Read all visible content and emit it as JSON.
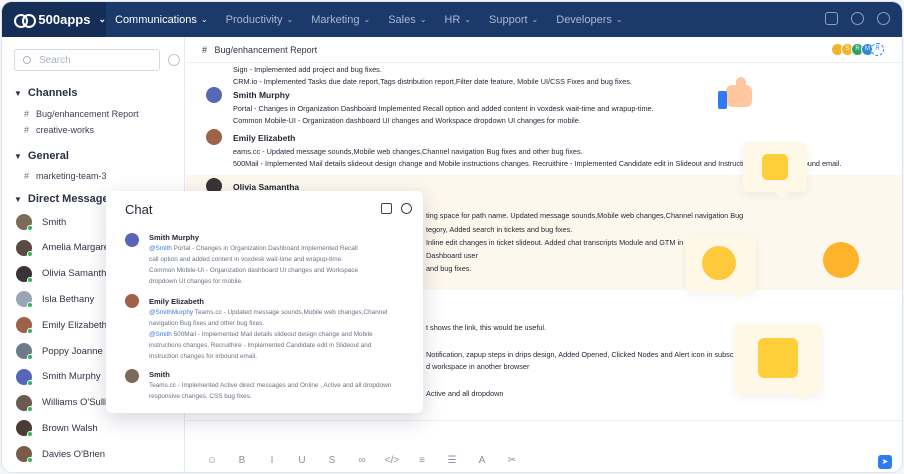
{
  "app": {
    "name": "500apps"
  },
  "nav": {
    "items": [
      {
        "label": "Communications",
        "active": true
      },
      {
        "label": "Productivity"
      },
      {
        "label": "Marketing"
      },
      {
        "label": "Sales"
      },
      {
        "label": "HR"
      },
      {
        "label": "Support"
      },
      {
        "label": "Developers"
      }
    ],
    "icons": [
      "apps-grid-icon",
      "help-icon",
      "settings-icon"
    ]
  },
  "sidebar": {
    "search_placeholder": "Search",
    "channels_title": "Channels",
    "channels": [
      "Bug/enhancement Report",
      "creative-works"
    ],
    "general_title": "General",
    "general": [
      "marketing-team-3"
    ],
    "dm_title": "Direct Messages",
    "direct_messages": [
      {
        "name": "Smith",
        "color": "#7c6a5a"
      },
      {
        "name": "Amelia Margaret",
        "color": "#5a4a42"
      },
      {
        "name": "Olivia Samantha",
        "color": "#3a3438"
      },
      {
        "name": "Isla Bethany",
        "color": "#9aa6b8"
      },
      {
        "name": "Emily Elizabeth",
        "color": "#a0614a"
      },
      {
        "name": "Poppy Joanne",
        "color": "#6e7c8a"
      },
      {
        "name": "Smith Murphy",
        "color": "#5866b8"
      },
      {
        "name": "Williams O'Sullivan",
        "color": "#6a5a50"
      },
      {
        "name": "Brown Walsh",
        "color": "#4a3c36"
      },
      {
        "name": "Davies O'Brien",
        "color": "#7a5c48"
      }
    ]
  },
  "main": {
    "hash": "#",
    "channel_title": "Bug/enhancement Report",
    "members": [
      "",
      "S",
      "R",
      "M",
      "R"
    ],
    "messages": [
      {
        "author": "",
        "lines": [
          "Sign - Implemented add project and bug fixes.",
          "CRM.io - Implemented Tasks due date report,Tags distribution report,Filter date feature, Mobile UI/CSS Fixes and bug fixes."
        ]
      },
      {
        "author": "Smith Murphy",
        "lines": [
          "Portal - Changes in Organization Dashboard Implemented Recall option and added content in voxdesk wait-time and wrapup-time.",
          "Common Mobile-UI - Organization dashboard UI changes and Workspace dropdown UI changes for mobile."
        ]
      },
      {
        "author": "Emily Elizabeth",
        "lines": [
          "eams.cc - Updated message sounds,Mobile web changes,Channel navigation Bug fixes and other bug fixes.",
          "500Mail - Implemented Mail details slideout design change and Mobile instructions changes. Recruithire - Implemented Candidate edit in Slideout and Instruction changes for inbound email."
        ]
      },
      {
        "author": "Olivia Samantha",
        "lines": [
          "ting space for path name. Updated message sounds,Mobile web changes,Channel navigation Bug",
          "tegory, Added search in tickets and bug fixes.",
          "Inline edit changes in ticket slideout. Added chat transcripts Module and GTM in",
          "Dashboard user",
          "and bug fixes."
        ]
      },
      {
        "author": "",
        "lines": [
          "t shows the link, this would be useful.",
          "Notification, zapup steps in drips design, Added Opened, Clicked Nodes and Alert icon in subscriberlist changes.",
          "d workspace in another browser",
          "Active and all dropdown"
        ]
      }
    ]
  },
  "toolbar": {
    "items": [
      {
        "name": "emoji-icon",
        "glyph": "☺"
      },
      {
        "name": "bold-icon",
        "glyph": "B"
      },
      {
        "name": "italic-icon",
        "glyph": "I"
      },
      {
        "name": "underline-icon",
        "glyph": "U"
      },
      {
        "name": "strikethrough-icon",
        "glyph": "S"
      },
      {
        "name": "link-icon",
        "glyph": "∞"
      },
      {
        "name": "code-icon",
        "glyph": "</>"
      },
      {
        "name": "ordered-list-icon",
        "glyph": "≡"
      },
      {
        "name": "bullet-list-icon",
        "glyph": "☰"
      },
      {
        "name": "text-color-icon",
        "glyph": "A"
      },
      {
        "name": "attachment-icon",
        "glyph": "✂"
      }
    ],
    "send_glyph": "➤"
  },
  "chat": {
    "title": "Chat",
    "messages": [
      {
        "author": "Smith Murphy",
        "lines": [
          {
            "mention": "@Smith",
            "text": " Portal - Changes in Organization Dashboard Implemented Recall"
          },
          {
            "mention": "",
            "text": "call option and added content in voxdesk wait-time and wrapup-time."
          },
          {
            "mention": "",
            "text": "Common Mobile-UI - Organization dashboard UI changes and Workspace"
          },
          {
            "mention": "",
            "text": "dropdown UI changes for mobile."
          }
        ]
      },
      {
        "author": "Emily Elizabeth",
        "lines": [
          {
            "mention": "@SmithMurphy",
            "text": " Teams.cc - Updated message sounds,Mobile web changes,Channel"
          },
          {
            "mention": "",
            "text": "navigation Bug fixes and other bug fixes."
          },
          {
            "mention": "@Smith",
            "text": " 500Mail - Implemented Mail details slideout design change and Mobile"
          },
          {
            "mention": "",
            "text": "instructions changes. Recruithire - Implemented Candidate edit in Slideout and"
          },
          {
            "mention": "",
            "text": "Instruction changes for inbound email."
          }
        ]
      },
      {
        "author": "Smith",
        "lines": [
          {
            "mention": "",
            "text": "Teams.cc - Implemented Active direct messages and Online , Active and all dropdown"
          },
          {
            "mention": "",
            "text": "responsive changes, CSS bug fixes."
          }
        ]
      }
    ]
  }
}
